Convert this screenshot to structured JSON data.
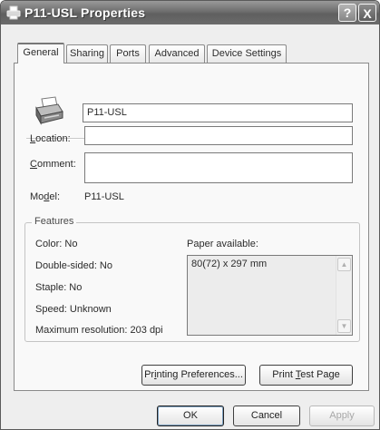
{
  "window": {
    "title": "P11-USL Properties",
    "help_glyph": "?",
    "close_glyph": "X"
  },
  "tabs": [
    {
      "label": "General",
      "active": true
    },
    {
      "label": "Sharing",
      "active": false
    },
    {
      "label": "Ports",
      "active": false
    },
    {
      "label": "Advanced",
      "active": false
    },
    {
      "label": "Device Settings",
      "active": false
    }
  ],
  "general": {
    "printer_name": "P11-USL",
    "location_label_prefix": "",
    "location_label_hotkey": "L",
    "location_label_rest": "ocation:",
    "location_value": "",
    "comment_label_hotkey": "C",
    "comment_label_rest": "omment:",
    "comment_value": "",
    "model_label_pre": "Mo",
    "model_label_hotkey": "d",
    "model_label_post": "el:",
    "model_value": "P11-USL"
  },
  "features": {
    "title": "Features",
    "color": "Color: No",
    "double_sided": "Double-sided: No",
    "staple": "Staple: No",
    "speed": "Speed: Unknown",
    "max_resolution": "Maximum resolution: 203 dpi",
    "paper_label": "Paper available:",
    "paper_items": [
      "80(72) x 297 mm"
    ]
  },
  "buttons": {
    "printing_prefs_pre": "Pr",
    "printing_prefs_hotkey": "i",
    "printing_prefs_post": "nting Preferences...",
    "print_test_pre": "Print ",
    "print_test_hotkey": "T",
    "print_test_post": "est Page",
    "ok": "OK",
    "cancel": "Cancel",
    "apply": "Apply"
  },
  "colors": {
    "titlebar": "#6e6e6e",
    "panel": "#f9f9f9",
    "dialog": "#eeeeee"
  }
}
